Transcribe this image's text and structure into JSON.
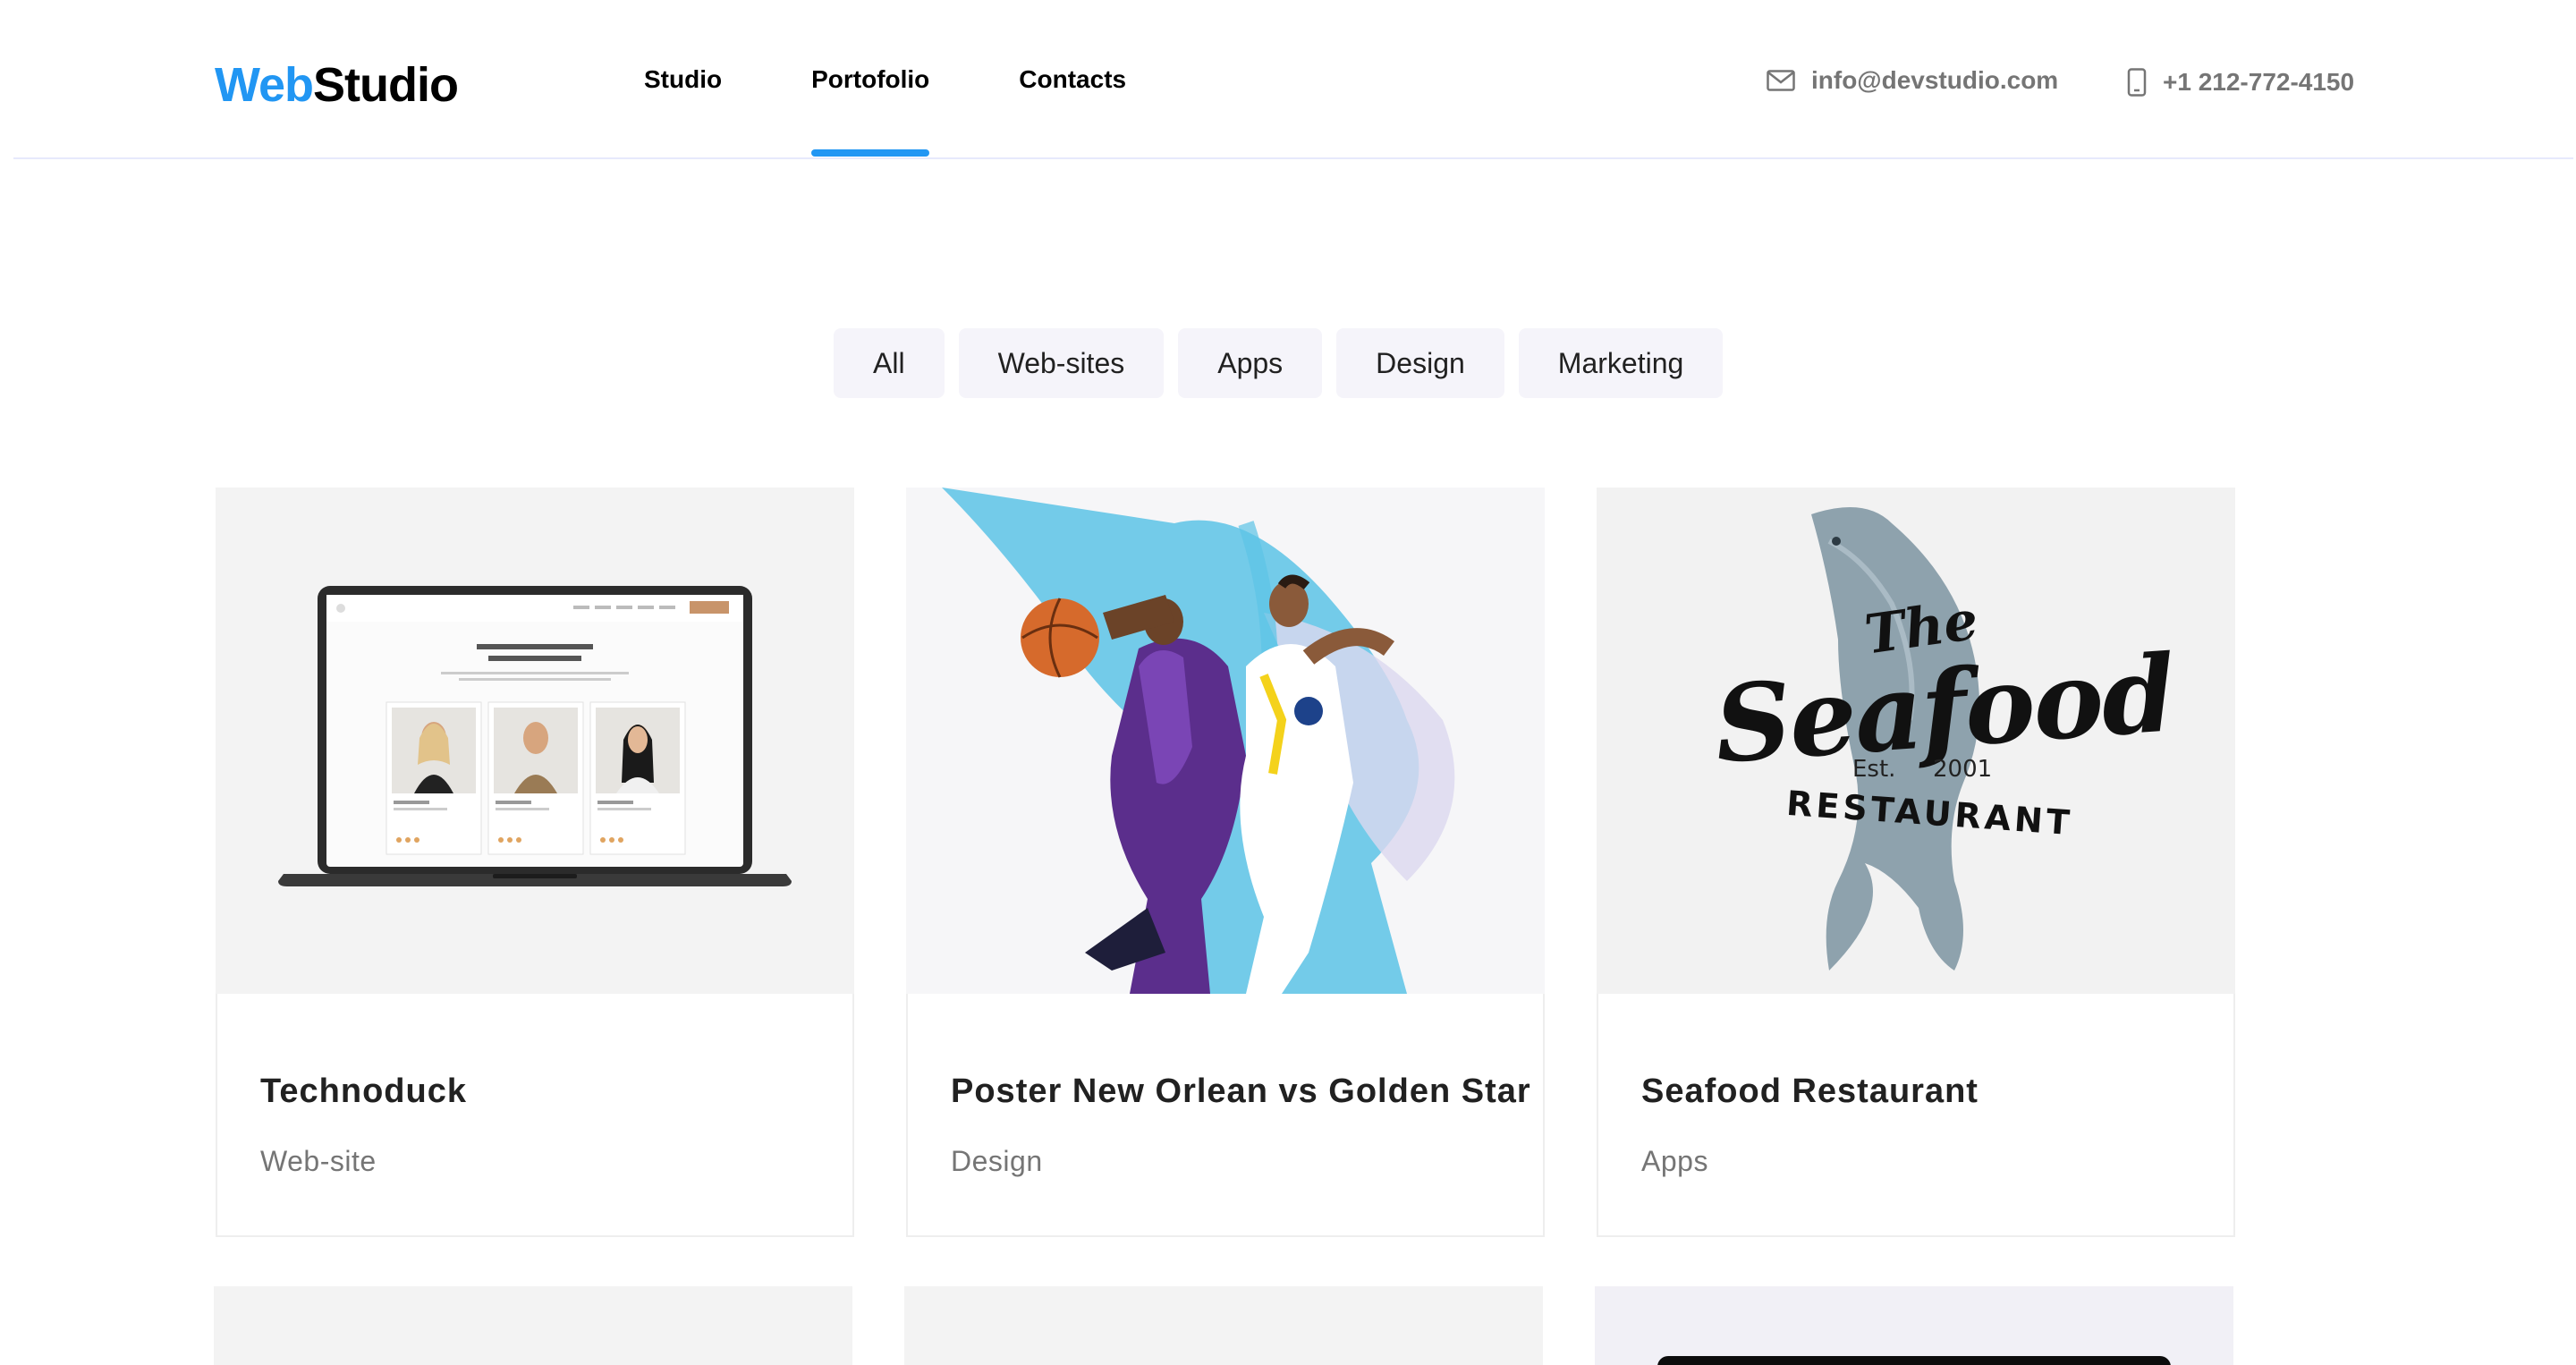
{
  "logo": {
    "part1": "Web",
    "part2": "Studio"
  },
  "nav": [
    {
      "label": "Studio",
      "active": false
    },
    {
      "label": "Portofolio",
      "active": true
    },
    {
      "label": "Contacts",
      "active": false
    }
  ],
  "contacts": {
    "email": {
      "icon": "mail-icon",
      "text": "info@devstudio.com"
    },
    "phone": {
      "icon": "phone-icon",
      "text": "+1 212-772-4150"
    }
  },
  "filters": [
    "All",
    "Web-sites",
    "Apps",
    "Design",
    "Marketing"
  ],
  "cards": [
    {
      "title": "Technoduck",
      "type": "Web-site",
      "image": "laptop-mockup"
    },
    {
      "title": "Poster New Orlean vs Golden Star",
      "type": "Design",
      "image": "basketball-poster"
    },
    {
      "title": "Seafood Restaurant",
      "type": "Apps",
      "image": "seafood-logo"
    }
  ],
  "seafood_logo": {
    "the": "The",
    "seafood": "Seafood",
    "est": "Est.",
    "year": "2001",
    "restaurant": "RESTAURANT"
  },
  "colors": {
    "accent": "#2196f3",
    "filter_bg": "#f5f4fa",
    "muted_text": "#757575"
  }
}
